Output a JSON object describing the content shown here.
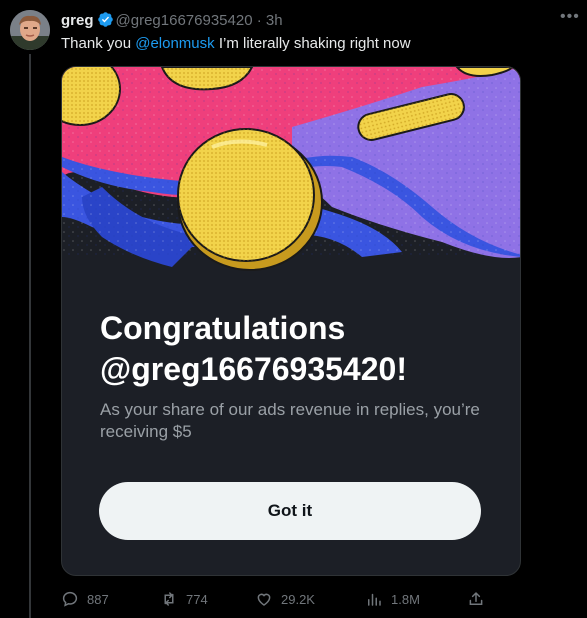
{
  "tweet": {
    "display_name": "greg",
    "handle": "@greg16676935420",
    "separator": "·",
    "time": "3h",
    "text_before": "Thank you ",
    "mention": "@elonmusk",
    "text_after": " I’m literally shaking right now"
  },
  "card": {
    "title_line1": "Congratulations",
    "title_line2": "@greg16676935420!",
    "subtitle": "As your share of our ads revenue in replies, you’re receiving $5",
    "button_label": "Got it"
  },
  "actions": {
    "replies": "887",
    "reposts": "774",
    "likes": "29.2K",
    "views": "1.8M"
  },
  "colors": {
    "accent": "#1d9bf0",
    "background": "#000000",
    "card_bg": "#1c1f26",
    "pink": "#ef3f7c",
    "blue": "#3a55e0",
    "purple": "#8f72e6",
    "coin": "#f2d34a"
  },
  "icons": [
    "verified-icon",
    "more-icon",
    "reply-icon",
    "repost-icon",
    "like-icon",
    "views-icon",
    "share-icon"
  ]
}
